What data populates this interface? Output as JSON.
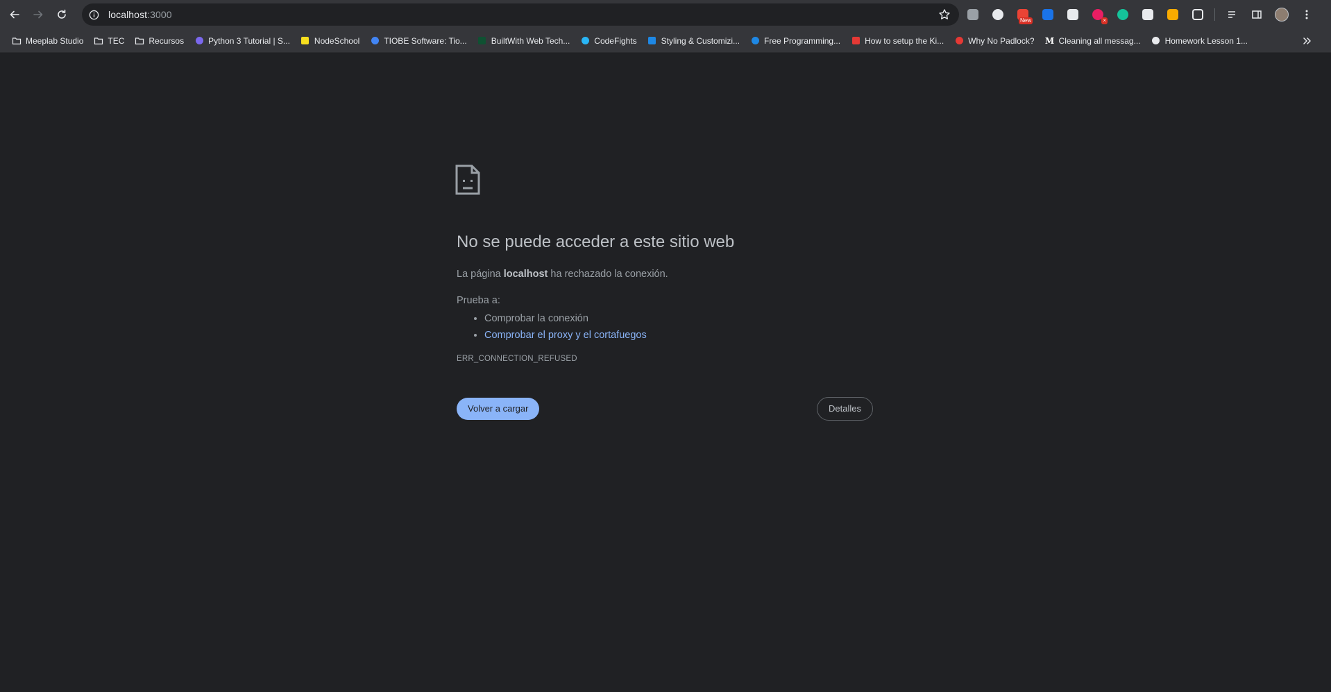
{
  "browser": {
    "url_host": "localhost",
    "url_port": ":3000",
    "extensions": [
      {
        "icon": "extension-k-icon",
        "color": "#9aa0a6"
      },
      {
        "icon": "extension-circle-icon",
        "color": "#e8eaed"
      },
      {
        "icon": "extension-new-icon",
        "color": "#ea4335",
        "badge": "New"
      },
      {
        "icon": "extension-check-icon",
        "color": "#1a73e8"
      },
      {
        "icon": "extension-window-icon",
        "color": "#e8eaed"
      },
      {
        "icon": "extension-record-icon",
        "color": "#e91e63",
        "badge": "×"
      },
      {
        "icon": "grammarly-icon",
        "color": "#15c39a"
      },
      {
        "icon": "extension-cloud-icon",
        "color": "#e8eaed"
      },
      {
        "icon": "extension-eyes-icon",
        "color": "#f9ab00"
      },
      {
        "icon": "extensions-puzzle-icon",
        "color": "#e8eaed"
      }
    ]
  },
  "bookmarks": [
    {
      "label": "Meeplab Studio",
      "icon": "folder-icon",
      "color": "#e8eaed"
    },
    {
      "label": "TEC",
      "icon": "folder-icon",
      "color": "#e8eaed"
    },
    {
      "label": "Recursos",
      "icon": "folder-icon",
      "color": "#e8eaed"
    },
    {
      "label": "Python 3 Tutorial | S...",
      "icon": "python-icon",
      "color": "#7b68ee"
    },
    {
      "label": "NodeSchool",
      "icon": "hexagon-icon",
      "color": "#f7df1e"
    },
    {
      "label": "TIOBE Software: Tio...",
      "icon": "diamond-icon",
      "color": "#4285f4"
    },
    {
      "label": "BuiltWith Web Tech...",
      "icon": "builtwith-icon",
      "color": "#0f5132"
    },
    {
      "label": "CodeFights",
      "icon": "codefights-icon",
      "color": "#29b6f6"
    },
    {
      "label": "Styling & Customizi...",
      "icon": "circle-logo-icon",
      "color": "#1e88e5"
    },
    {
      "label": "Free Programming...",
      "icon": "cloud-logo-icon",
      "color": "#1e88e5"
    },
    {
      "label": "How to setup the Ki...",
      "icon": "logo-red-icon",
      "color": "#e53935"
    },
    {
      "label": "Why No Padlock?",
      "icon": "padlock-icon",
      "color": "#e53935"
    },
    {
      "label": "Cleaning all messag...",
      "icon": "medium-icon",
      "color": "#ffffff"
    },
    {
      "label": "Homework Lesson 1...",
      "icon": "book-icon",
      "color": "#e8eaed"
    }
  ],
  "error": {
    "title": "No se puede acceder a este sitio web",
    "desc_prefix": "La página ",
    "desc_host": "localhost",
    "desc_suffix": " ha rechazado la conexión.",
    "suggest_head": "Prueba a:",
    "suggestions": [
      {
        "label": "Comprobar la conexión",
        "link": false
      },
      {
        "label": "Comprobar el proxy y el cortafuegos",
        "link": true
      }
    ],
    "code": "ERR_CONNECTION_REFUSED",
    "reload_label": "Volver a cargar",
    "details_label": "Detalles"
  },
  "colors": {
    "accent": "#8ab4f8",
    "background": "#202124",
    "chrome": "#35363a"
  }
}
